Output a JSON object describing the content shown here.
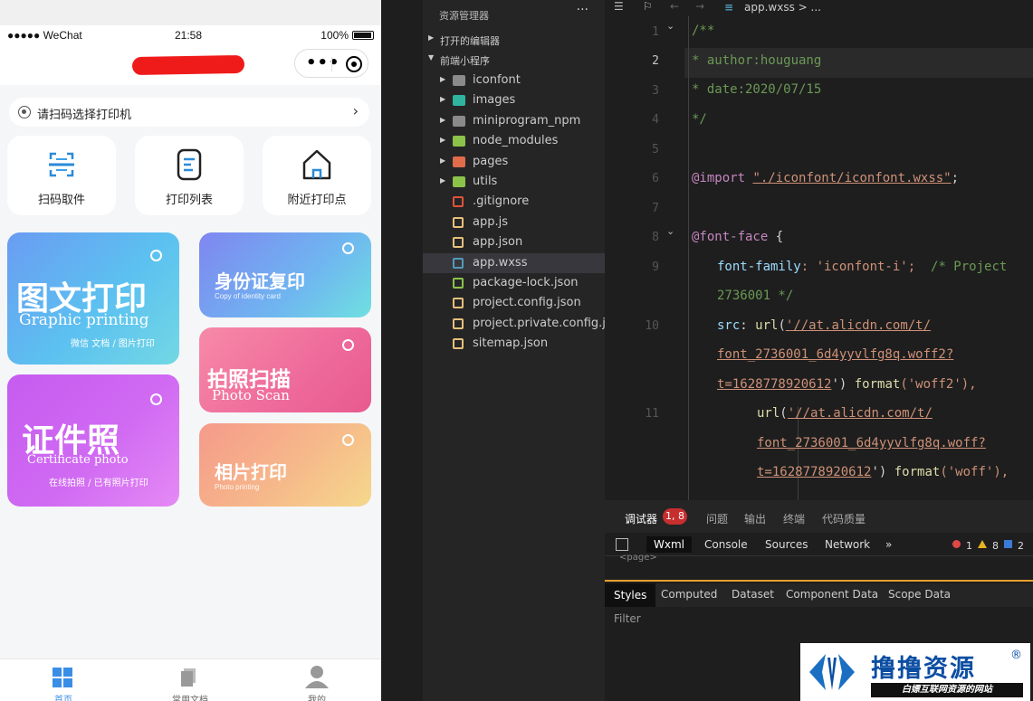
{
  "phone": {
    "status": {
      "carrier": "●●●●● WeChat",
      "time": "21:58",
      "battery": "100%"
    },
    "scan_prompt": "请扫码选择打印机",
    "actions": [
      {
        "label": "扫码取件",
        "icon": "scan-icon"
      },
      {
        "label": "打印列表",
        "icon": "list-icon"
      },
      {
        "label": "附近打印点",
        "icon": "home-icon"
      }
    ],
    "cards": {
      "graphic": {
        "title": "图文打印",
        "subtitle": "Graphic printing",
        "tag": "微信 文档 / 图片打印"
      },
      "id_copy": {
        "title": "身份证复印",
        "subtitle": "Copy of identity card"
      },
      "photo_scan": {
        "title": "拍照扫描",
        "subtitle": "Photo Scan"
      },
      "certificate": {
        "title": "证件照",
        "subtitle": "Certificate photo",
        "tag": "在线拍照 / 已有照片打印"
      },
      "photo_print": {
        "title": "相片打印",
        "subtitle": "Photo printing"
      }
    },
    "tabbar": [
      {
        "label": "首页",
        "icon": "grid-icon"
      },
      {
        "label": "常用文档",
        "icon": "document-icon"
      },
      {
        "label": "我的",
        "icon": "user-icon"
      }
    ]
  },
  "explorer": {
    "header": "资源管理器",
    "more": "···",
    "sections": {
      "open_editors": "打开的编辑器",
      "project": "前端小程序"
    },
    "files": [
      {
        "name": "iconfont",
        "kind": "folder",
        "color": "#8a8a8a"
      },
      {
        "name": "images",
        "kind": "folder",
        "color": "#2fb4a0"
      },
      {
        "name": "miniprogram_npm",
        "kind": "folder",
        "color": "#8a8a8a"
      },
      {
        "name": "node_modules",
        "kind": "folder",
        "color": "#8bc34a"
      },
      {
        "name": "pages",
        "kind": "folder",
        "color": "#e06c4c"
      },
      {
        "name": "utils",
        "kind": "folder",
        "color": "#8bc34a"
      },
      {
        "name": ".gitignore",
        "kind": "file",
        "color": "#e0533a"
      },
      {
        "name": "app.js",
        "kind": "file",
        "color": "#e5c07b"
      },
      {
        "name": "app.json",
        "kind": "file",
        "color": "#e5c07b"
      },
      {
        "name": "app.wxss",
        "kind": "file",
        "color": "#519aba"
      },
      {
        "name": "package-lock.json",
        "kind": "file",
        "color": "#8bc34a"
      },
      {
        "name": "project.config.json",
        "kind": "file",
        "color": "#e5c07b"
      },
      {
        "name": "project.private.config.js...",
        "kind": "file",
        "color": "#e5c07b"
      },
      {
        "name": "sitemap.json",
        "kind": "file",
        "color": "#e5c07b"
      }
    ],
    "selected": "app.wxss"
  },
  "editor": {
    "breadcrumb": "app.wxss > ...",
    "line_numbers": [
      "1",
      "2",
      "3",
      "4",
      "5",
      "6",
      "7",
      "8",
      "9",
      "",
      "10",
      "",
      "",
      "11",
      "",
      ""
    ],
    "code": {
      "l1": "/**",
      "l2": "* author:houguang",
      "l3": "* date:2020/07/15",
      "l4": "*/",
      "l6_kw": "@import",
      "l6_str": "\"./iconfont/iconfont.wxss\"",
      "l6_end": ";",
      "l8_kw": "@font-face",
      "l8_end": " {",
      "l9_prop": "font-family",
      "l9_val": ": 'iconfont-i';",
      "l9_comment": "  /* Project",
      "l9b_comment": "2736001 */",
      "l10_prop": "src",
      "l10_mid": ": ",
      "l10_fn": "url",
      "l10_str1": "'//at.alicdn.com/t/",
      "l10_str2": "font_2736001_6d4yyvlfg8q.woff2?",
      "l10_str3": "t=1628778920612",
      "l10_end": "') ",
      "l10_fn2": "format",
      "l10_fmt": "('woff2'),",
      "l11_fn": "url",
      "l11_str1": "'//at.alicdn.com/t/",
      "l11_str2": "font_2736001_6d4yyvlfg8q.woff?",
      "l11_str3": "t=1628778920612",
      "l11_end": "') ",
      "l11_fn2": "format",
      "l11_fmt": "('woff'),"
    }
  },
  "debug": {
    "tabs": [
      "调试器",
      "问题",
      "输出",
      "终端",
      "代码质量"
    ],
    "badge": "1, 8",
    "subtabs": [
      "Wxml",
      "Console",
      "Sources",
      "Network",
      "»"
    ],
    "counts": {
      "errors": "1",
      "warnings": "8",
      "info": "2"
    },
    "wxml_text": "<page>",
    "styles_tabs": [
      "Styles",
      "Computed",
      "Dataset",
      "Component Data",
      "Scope Data"
    ],
    "filter": "Filter"
  },
  "watermark": {
    "title": "撸撸资源",
    "reg": "®",
    "subtitle": "白嫖互联网资源的网站"
  }
}
